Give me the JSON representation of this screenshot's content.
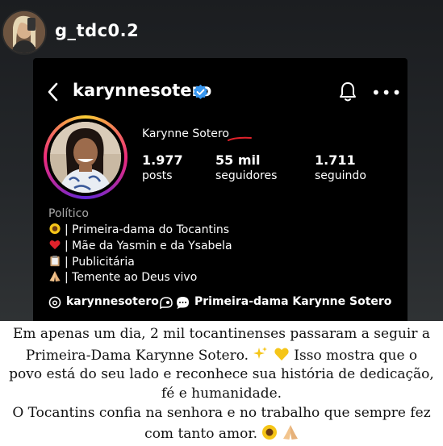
{
  "story": {
    "username": "g_tdc0.2"
  },
  "profile": {
    "username": "karynnesotero",
    "display_name": "Karynne Sotero",
    "stats": [
      {
        "value": "1.977",
        "label": "posts"
      },
      {
        "value": "55 mil",
        "label": "seguidores"
      },
      {
        "value": "1.711",
        "label": "seguindo"
      }
    ],
    "category": "Político",
    "bio": [
      {
        "icon": "sunflower-icon",
        "text": "| Primeira-dama do Tocantins"
      },
      {
        "icon": "heart-icon",
        "text": "| Mãe da Yasmin e da Ysabela"
      },
      {
        "icon": "clipboard-icon",
        "text": "| Publicitária"
      },
      {
        "icon": "praying-hands-icon",
        "text": "| Temente ao Deus vivo"
      }
    ],
    "threads_handle": "karynnesotero",
    "channel_name": "Primeira-dama Karynne Sotero"
  },
  "caption": {
    "line1": "Em apenas um dia, 2 mil tocantinenses passaram a seguir a",
    "line2": "Primeira-Dama Karynne Sotero.",
    "line2b": "Isso mostra que o",
    "line3": "povo está do seu lado e reconhece sua história de dedicação,",
    "line4": "fé e humanidade.",
    "line5": "O  Tocantins confia na senhora e no trabalho que sempre fez",
    "line6": "com tanto amor."
  },
  "colors": {
    "verified": "#3897f0",
    "mark": "#e0222b",
    "category": "#a8a8a8"
  }
}
